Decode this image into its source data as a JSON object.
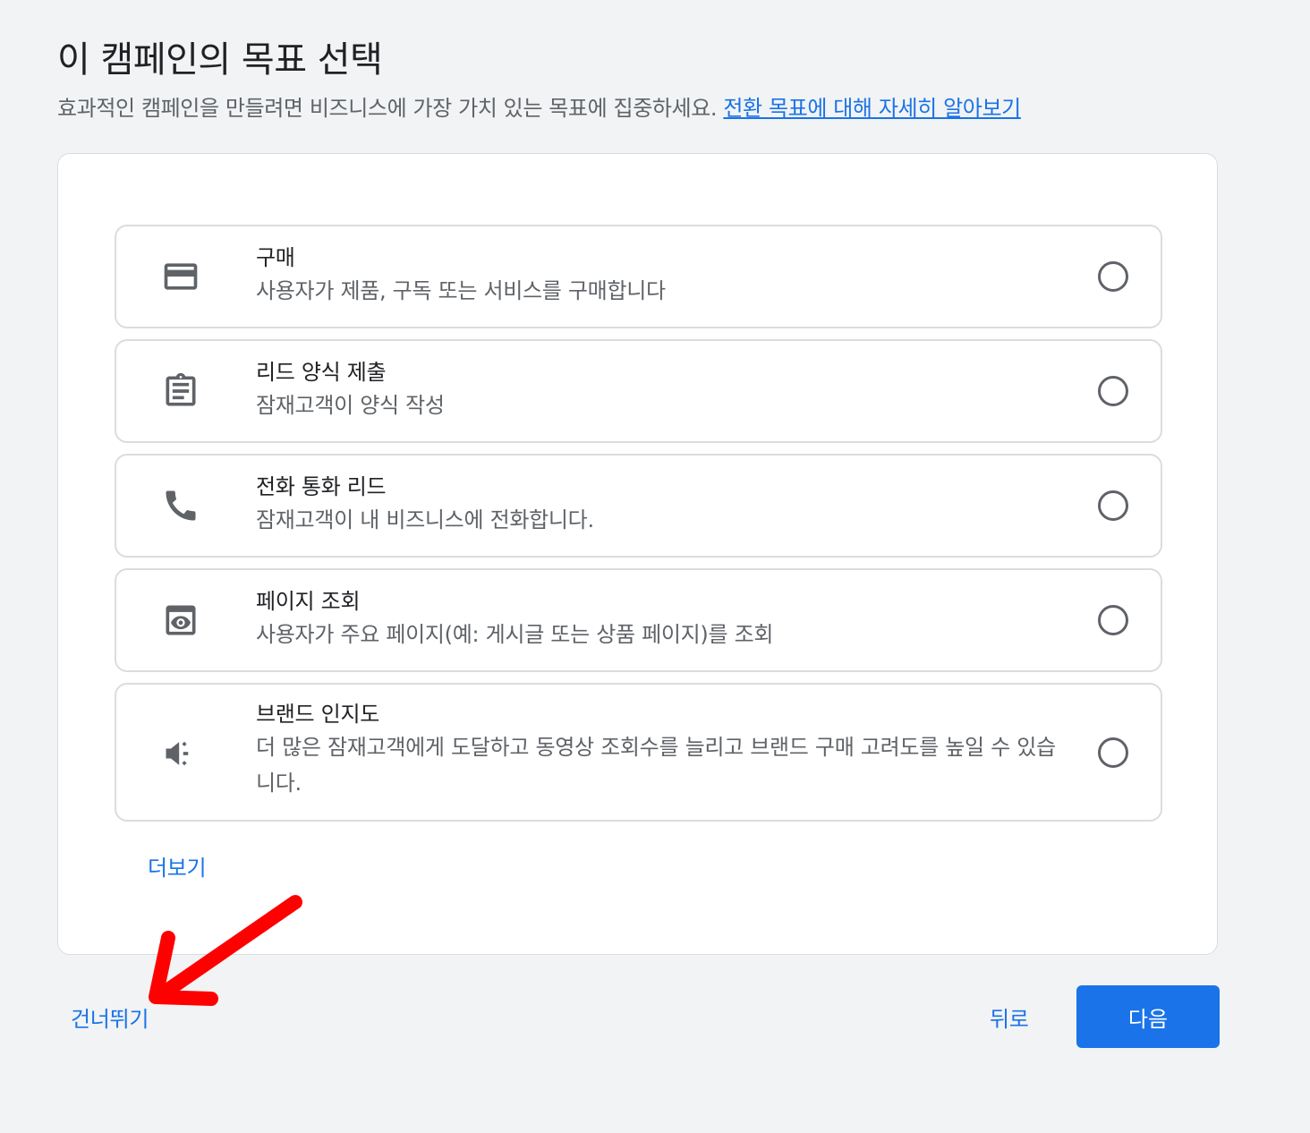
{
  "header": {
    "title": "이 캠페인의 목표 선택",
    "subtitle": "효과적인 캠페인을 만들려면 비즈니스에 가장 가치 있는 목표에 집중하세요.",
    "learn_more_link": "전환 목표에 대해 자세히 알아보기"
  },
  "options": [
    {
      "title": "구매",
      "description": "사용자가 제품, 구독 또는 서비스를 구매합니다",
      "icon": "credit-card-icon",
      "selected": false
    },
    {
      "title": "리드 양식 제출",
      "description": "잠재고객이 양식 작성",
      "icon": "clipboard-icon",
      "selected": false
    },
    {
      "title": "전화 통화 리드",
      "description": "잠재고객이 내 비즈니스에 전화합니다.",
      "icon": "phone-icon",
      "selected": false
    },
    {
      "title": "페이지 조회",
      "description": "사용자가 주요 페이지(예: 게시글 또는 상품 페이지)를 조회",
      "icon": "eye-page-icon",
      "selected": false
    },
    {
      "title": "브랜드 인지도",
      "description": "더 많은 잠재고객에게 도달하고 동영상 조회수를 늘리고 브랜드 구매 고려도를 높일 수 있습니다.",
      "icon": "megaphone-icon",
      "selected": false
    }
  ],
  "card": {
    "more_label": "더보기"
  },
  "footer": {
    "skip_label": "건너뛰기",
    "back_label": "뒤로",
    "next_label": "다음"
  },
  "colors": {
    "accent": "#1a73e8",
    "annotation": "#ff0000",
    "border": "#dadce0",
    "icon": "#5f6368"
  }
}
